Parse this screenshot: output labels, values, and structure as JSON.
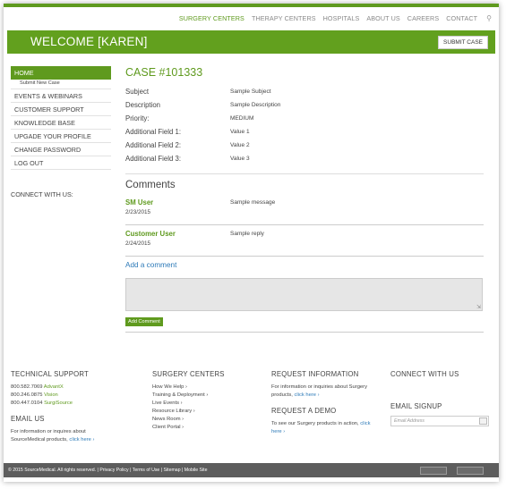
{
  "topnav": {
    "items": [
      "SURGERY CENTERS",
      "THERAPY CENTERS",
      "HOSPITALS",
      "ABOUT US",
      "CAREERS",
      "CONTACT"
    ]
  },
  "banner": {
    "welcome": "WELCOME [KAREN]",
    "submit_case": "SUBMIT CASE"
  },
  "sidebar": {
    "home": "HOME",
    "submit_new_case": "Submit New Case",
    "items": [
      "EVENTS & WEBINARS",
      "CUSTOMER SUPPORT",
      "KNOWLEDGE BASE",
      "UPGADE YOUR PROFILE",
      "CHANGE PASSWORD",
      "LOG OUT"
    ],
    "connect": "CONNECT WITH US:"
  },
  "case": {
    "title": "CASE #101333",
    "fields": [
      {
        "label": "Subject",
        "value": "Sample Subject"
      },
      {
        "label": "Description",
        "value": "Sample Description"
      },
      {
        "label": "Priority:",
        "value": "MEDIUM"
      },
      {
        "label": "Additional Field 1:",
        "value": "Value 1"
      },
      {
        "label": "Additional Field 2:",
        "value": "Value 2"
      },
      {
        "label": "Additional Field 3:",
        "value": "Value 3"
      }
    ]
  },
  "comments": {
    "title": "Comments",
    "items": [
      {
        "author": "SM User",
        "date": "2/23/2015",
        "message": "Sample message"
      },
      {
        "author": "Customer User",
        "date": "2/24/2015",
        "message": "Sample reply"
      }
    ],
    "add_link": "Add a comment",
    "add_button": "Add Comment"
  },
  "footer": {
    "tech": {
      "title": "TECHNICAL SUPPORT",
      "lines": [
        {
          "phone": "800.582.7069",
          "brand": "AdvantX"
        },
        {
          "phone": "800.246.0875",
          "brand": "Vision"
        },
        {
          "phone": "800.447.0104",
          "brand": "SurgiSource"
        }
      ]
    },
    "email_us": {
      "title": "EMAIL US",
      "text": "For information or inquires about SourceMedical products,",
      "link": "click here ›"
    },
    "surgery": {
      "title": "SURGERY CENTERS",
      "muted": "How We Help ›",
      "links": [
        "Training & Deployment ›",
        "Live Events ›",
        "Resource Library ›",
        "News Room ›",
        "Client Portal ›"
      ]
    },
    "request_info": {
      "title": "REQUEST INFORMATION",
      "text": "For information or inquiries about Surgery products,",
      "link": "click here ›"
    },
    "request_demo": {
      "title": "REQUEST A DEMO",
      "text": "To see our Surgery products in action,",
      "link": "click here ›"
    },
    "connect": {
      "title": "CONNECT WITH US"
    },
    "signup": {
      "title": "EMAIL SIGNUP",
      "placeholder": "Email Address"
    }
  },
  "bottom": {
    "copyright": "© 2015 SourceMedical. All rights reserved.  |  Privacy Policy  |  Terms of Use  |  Sitemap  |  Mobile Site"
  },
  "colors": {
    "accent": "#5f9a1e",
    "link": "#2d7ab8",
    "footer_bar": "#5d5d5d"
  }
}
